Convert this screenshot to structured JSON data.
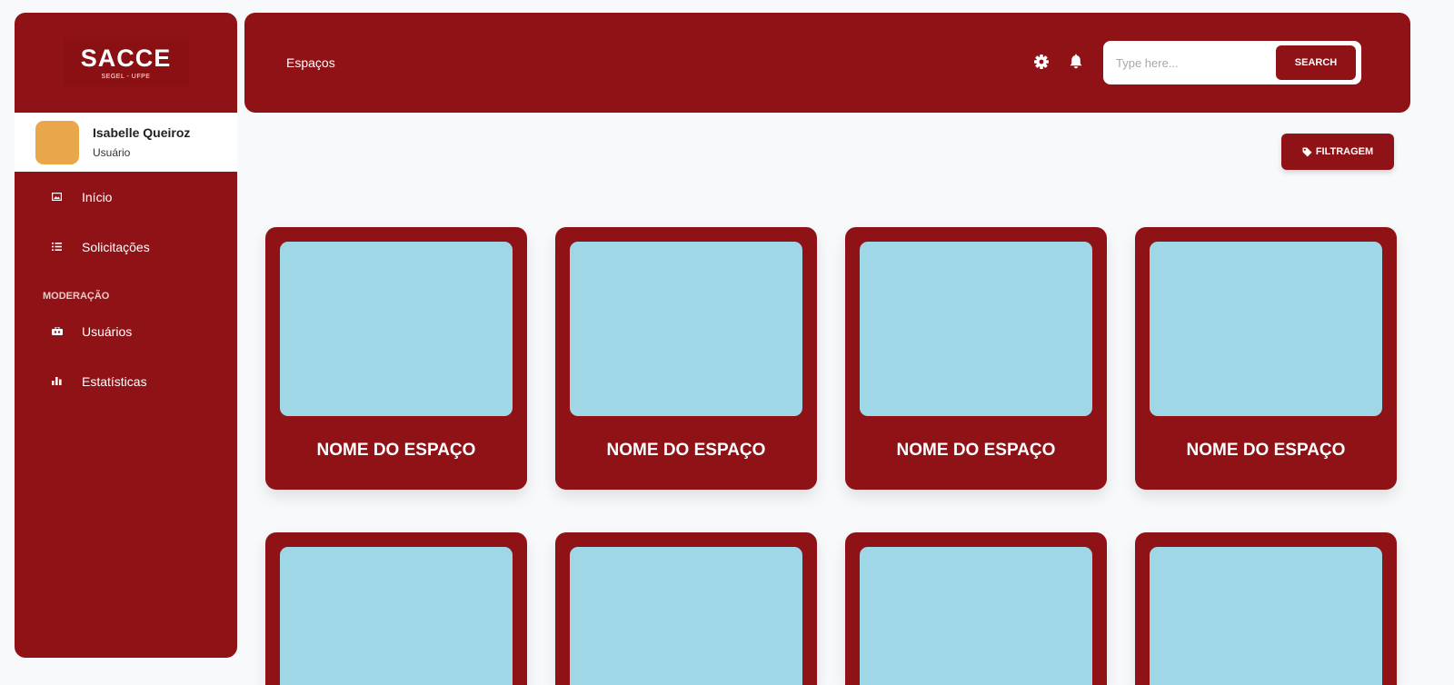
{
  "sidebar": {
    "logo": {
      "title": "SACCE",
      "subtitle": "SEGEL - UFPE"
    },
    "user": {
      "name": "Isabelle Queiroz",
      "role": "Usuário"
    },
    "items": [
      {
        "label": "Início",
        "icon": "image-icon"
      },
      {
        "label": "Solicitações",
        "icon": "list-icon"
      }
    ],
    "section_label": "MODERAÇÃO",
    "moderation_items": [
      {
        "label": "Usuários",
        "icon": "users-icon"
      },
      {
        "label": "Estatísticas",
        "icon": "bar-chart-icon"
      }
    ]
  },
  "header": {
    "title": "Espaços",
    "search_placeholder": "Type here...",
    "search_label": "SEARCH"
  },
  "filter": {
    "label": "FILTRAGEM"
  },
  "cards": [
    {
      "title": "NOME DO ESPAÇO"
    },
    {
      "title": "NOME DO ESPAÇO"
    },
    {
      "title": "NOME DO ESPAÇO"
    },
    {
      "title": "NOME DO ESPAÇO"
    },
    {
      "title": ""
    },
    {
      "title": ""
    },
    {
      "title": ""
    },
    {
      "title": ""
    }
  ],
  "colors": {
    "primary": "#8f1216",
    "card_image": "#9fd7e7",
    "avatar": "#eaa64a",
    "background": "#f8f9fb"
  }
}
